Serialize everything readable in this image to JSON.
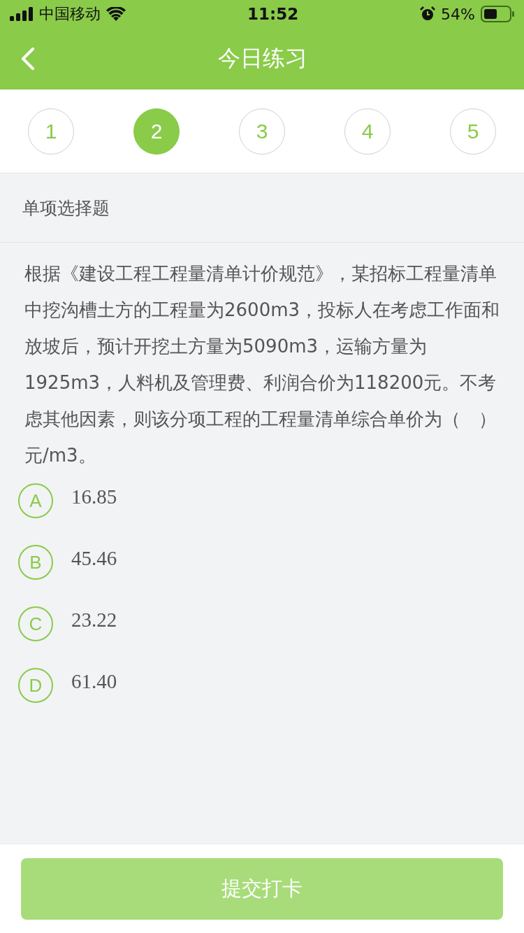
{
  "status_bar": {
    "carrier": "中国移动",
    "time": "11:52",
    "battery": "54%"
  },
  "nav": {
    "title": "今日练习"
  },
  "steps": [
    {
      "label": "1",
      "selected": false
    },
    {
      "label": "2",
      "selected": true
    },
    {
      "label": "3",
      "selected": false
    },
    {
      "label": "4",
      "selected": false
    },
    {
      "label": "5",
      "selected": false
    }
  ],
  "question_type": "单项选择题",
  "question": "根据《建设工程工程量清单计价规范》，某招标工程量清单中挖沟槽土方的工程量为2600m3，投标人在考虑工作面和放坡后，预计开挖土方量为5090m3，运输方量为1925m3，人料机及管理费、利润合价为118200元。不考虑其他因素，则该分项工程的工程量清单综合单价为（　）元/m3。",
  "options": [
    {
      "letter": "A",
      "text": "16.85",
      "selected": false
    },
    {
      "letter": "B",
      "text": "45.46",
      "selected": false
    },
    {
      "letter": "C",
      "text": "23.22",
      "selected": false
    },
    {
      "letter": "D",
      "text": "61.40",
      "selected": false
    }
  ],
  "submit": {
    "label": "提交打卡",
    "disabled": true
  }
}
